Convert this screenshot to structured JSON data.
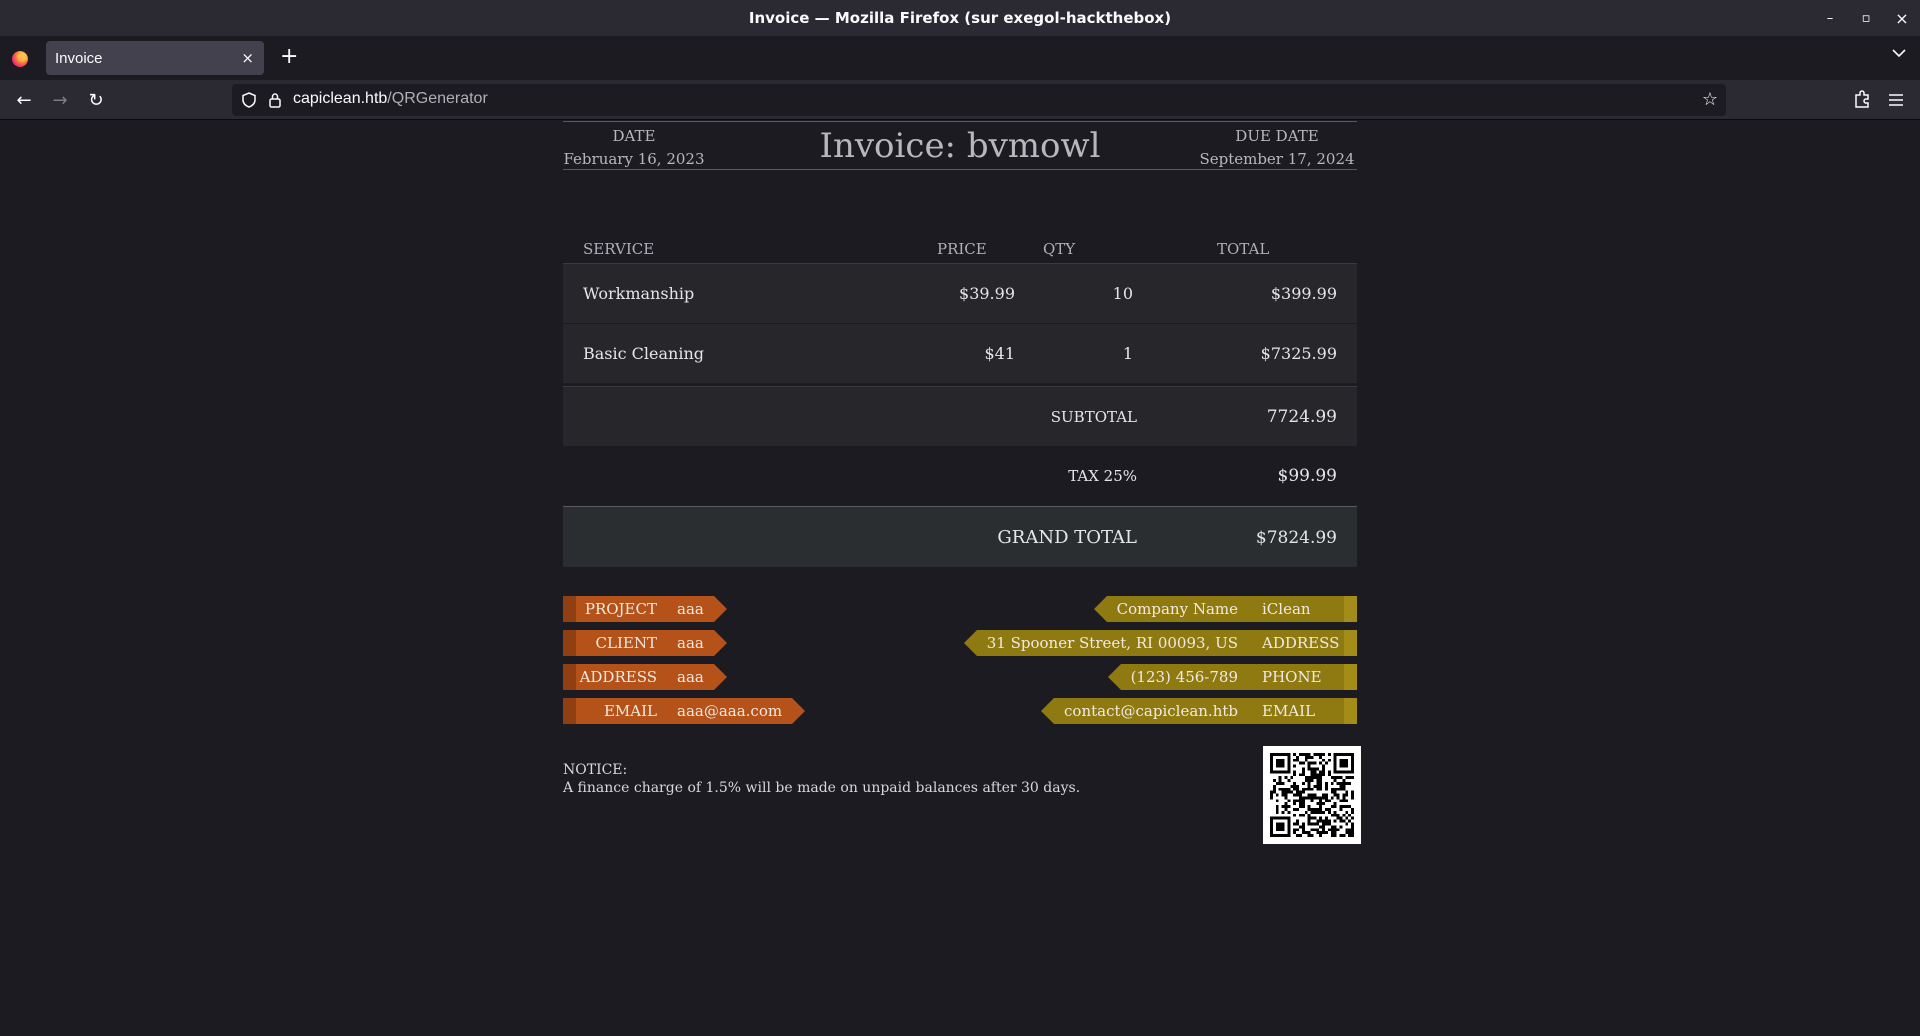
{
  "window": {
    "title": "Invoice — Mozilla Firefox (sur exegol-hackthebox)",
    "controls": {
      "minimize": "–",
      "maximize": "▫",
      "close": "×"
    }
  },
  "tabs": [
    {
      "label": "Invoice",
      "close": "×"
    }
  ],
  "tabstrip": {
    "new_tab": "+",
    "list_all": "⌄"
  },
  "nav": {
    "back": "←",
    "forward": "→",
    "reload": "↻",
    "url_host": "capiclean.htb",
    "url_path": "/QRGenerator",
    "bookmark": "☆"
  },
  "invoice": {
    "date_label": "DATE",
    "date_value": "February 16, 2023",
    "title": "Invoice: bvmowl",
    "due_label": "DUE DATE",
    "due_value": "September 17, 2024",
    "columns": [
      "SERVICE",
      "PRICE",
      "QTY",
      "TOTAL"
    ],
    "items": [
      {
        "service": "Workmanship",
        "price": "$39.99",
        "qty": "10",
        "total": "$399.99"
      },
      {
        "service": "Basic Cleaning",
        "price": "$41",
        "qty": "1",
        "total": "$7325.99"
      }
    ],
    "subtotal_label": "SUBTOTAL",
    "subtotal_value": "7724.99",
    "tax_label": "TAX 25%",
    "tax_value": "$99.99",
    "grand_label": "GRAND TOTAL",
    "grand_value": "$7824.99",
    "client_fields": [
      {
        "key": "PROJECT",
        "value": "aaa"
      },
      {
        "key": "CLIENT",
        "value": "aaa"
      },
      {
        "key": "ADDRESS",
        "value": "aaa"
      },
      {
        "key": "EMAIL",
        "value": "aaa@aaa.com"
      }
    ],
    "company_fields": [
      {
        "key": "Company Name",
        "value": "iClean"
      },
      {
        "key": "ADDRESS",
        "value": "31 Spooner Street, RI 00093, US"
      },
      {
        "key": "PHONE",
        "value": "(123) 456-789"
      },
      {
        "key": "EMAIL",
        "value": "contact@capiclean.htb"
      }
    ],
    "notice_title": "NOTICE:",
    "notice_text": "A finance charge of 1.5% will be made on unpaid balances after 30 days."
  },
  "colors": {
    "client_ribbon": "#b5521a",
    "company_ribbon": "#8f7a12",
    "page_bg": "#1c1b22"
  },
  "icons": [
    "firefox-logo-icon",
    "shield-icon",
    "lock-icon",
    "star-icon",
    "extensions-icon",
    "hamburger-menu-icon",
    "qr-code-icon"
  ]
}
